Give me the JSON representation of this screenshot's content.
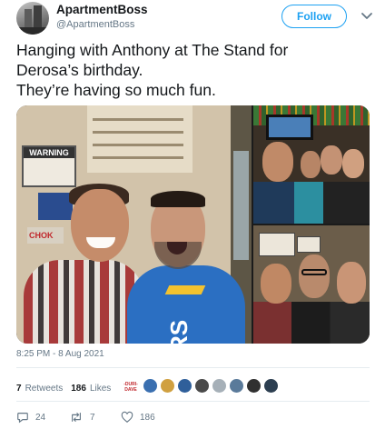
{
  "account": {
    "name": "ApartmentBoss",
    "handle": "@ApartmentBoss",
    "follow_label": "Follow"
  },
  "tweet": {
    "lines": [
      "Hanging with Anthony at The Stand for",
      "Derosa’s birthday.",
      "They’re having so much fun."
    ],
    "timestamp": "8:25 PM - 8 Aug 2021"
  },
  "media": {
    "sign_warning": "WARNING",
    "sign_red": "CHOK",
    "hoodie_text": "RS"
  },
  "stats": {
    "retweets_count": "7",
    "retweets_label": "Retweets",
    "likes_count": "186",
    "likes_label": "Likes",
    "first_liker_text": "-DURI- DAVE"
  },
  "likers": [
    {
      "icon": "avatar-liker-text"
    },
    {
      "icon": "avatar-liker",
      "color": "#3a6fb0"
    },
    {
      "icon": "avatar-liker",
      "color": "#d0a040"
    },
    {
      "icon": "avatar-liker",
      "color": "#2f5f9a"
    },
    {
      "icon": "avatar-liker",
      "color": "#4a4a4a"
    },
    {
      "icon": "avatar-liker",
      "color": "#a6b0b8"
    },
    {
      "icon": "avatar-liker",
      "color": "#5a7a9a"
    },
    {
      "icon": "avatar-liker",
      "color": "#303030"
    },
    {
      "icon": "avatar-liker",
      "color": "#2c3e50"
    }
  ],
  "actions": {
    "reply_count": "24",
    "retweet_count": "7",
    "like_count": "186"
  },
  "colors": {
    "accent": "#1da1f2",
    "muted": "#657786",
    "text": "#14171a"
  }
}
